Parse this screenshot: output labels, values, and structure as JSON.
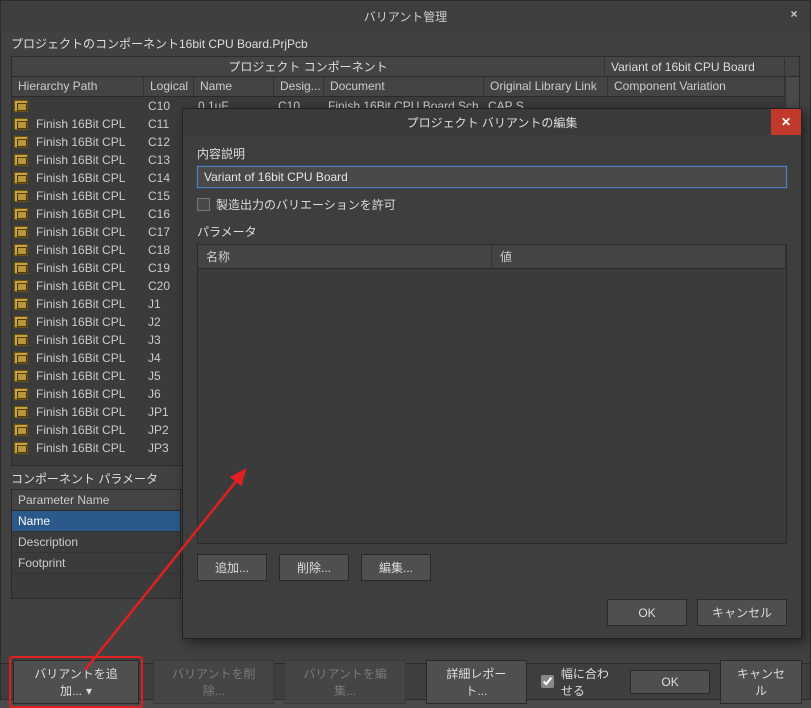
{
  "main": {
    "title": "バリアント管理",
    "projectLabel": "プロジェクトのコンポーネント16bit CPU Board.PrjPcb",
    "groupProjectComponents": "プロジェクト コンポーネント",
    "variantColumnHeader": "Variant of 16bit CPU Board",
    "columns": {
      "hierarchy": "Hierarchy Path",
      "logical": "Logical",
      "name": "Name",
      "designator": "Desig...",
      "document": "Document",
      "origLibLink": "Original Library Link",
      "variation": "Component Variation"
    },
    "firstDataRow": {
      "logical": "C10",
      "name": "0.1uF",
      "desig": "C10",
      "document": "Finish 16Bit CPU Board Sch",
      "lib": "CAP S"
    },
    "rows": [
      {
        "logical": "C11",
        "path": "Finish 16Bit CPL"
      },
      {
        "logical": "C12",
        "path": "Finish 16Bit CPL"
      },
      {
        "logical": "C13",
        "path": "Finish 16Bit CPL"
      },
      {
        "logical": "C14",
        "path": "Finish 16Bit CPL"
      },
      {
        "logical": "C15",
        "path": "Finish 16Bit CPL"
      },
      {
        "logical": "C16",
        "path": "Finish 16Bit CPL"
      },
      {
        "logical": "C17",
        "path": "Finish 16Bit CPL"
      },
      {
        "logical": "C18",
        "path": "Finish 16Bit CPL"
      },
      {
        "logical": "C19",
        "path": "Finish 16Bit CPL"
      },
      {
        "logical": "C20",
        "path": "Finish 16Bit CPL"
      },
      {
        "logical": "J1",
        "path": "Finish 16Bit CPL"
      },
      {
        "logical": "J2",
        "path": "Finish 16Bit CPL"
      },
      {
        "logical": "J3",
        "path": "Finish 16Bit CPL"
      },
      {
        "logical": "J4",
        "path": "Finish 16Bit CPL"
      },
      {
        "logical": "J5",
        "path": "Finish 16Bit CPL"
      },
      {
        "logical": "J6",
        "path": "Finish 16Bit CPL"
      },
      {
        "logical": "JP1",
        "path": "Finish 16Bit CPL"
      },
      {
        "logical": "JP2",
        "path": "Finish 16Bit CPL"
      },
      {
        "logical": "JP3",
        "path": "Finish 16Bit CPL"
      }
    ],
    "componentParamLabel": "コンポーネント パラメータ",
    "params": {
      "header": "Parameter Name",
      "items": [
        "Name",
        "Description",
        "Footprint"
      ]
    }
  },
  "bottombar": {
    "addVariant": "バリアントを追加...",
    "deleteVariant": "バリアントを削除...",
    "editVariant": "バリアントを編集...",
    "detailReport": "詳細レポート...",
    "fitWidth": "幅に合わせる",
    "ok": "OK",
    "cancel": "キャンセル"
  },
  "editDialog": {
    "title": "プロジェクト バリアントの編集",
    "descLabel": "内容説明",
    "descValue": "Variant of 16bit CPU Board",
    "allowFabVariation": "製造出力のバリエーションを許可",
    "parameters": "パラメータ",
    "cols": {
      "name": "名称",
      "value": "値"
    },
    "add": "追加...",
    "del": "削除...",
    "edit": "編集...",
    "ok": "OK",
    "cancel": "キャンセル"
  }
}
